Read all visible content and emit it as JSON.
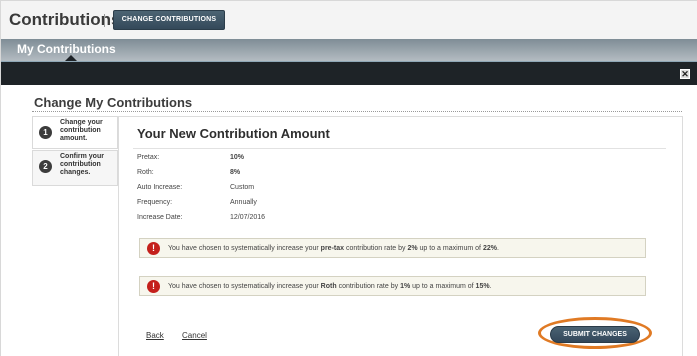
{
  "header": {
    "title": "Contributions",
    "change_button": "CHANGE CONTRIBUTIONS",
    "sub_tab": "My Contributions",
    "close_glyph": "✕"
  },
  "modal": {
    "title": "Change My Contributions",
    "steps": [
      {
        "number": "1",
        "label": "Change your contribution amount."
      },
      {
        "number": "2",
        "label": "Confirm your contribution changes."
      }
    ],
    "panel_title": "Your New Contribution Amount",
    "fields": [
      {
        "key": "Pretax:",
        "value": "10%"
      },
      {
        "key": "Roth:",
        "value": "8%"
      },
      {
        "key": "Auto Increase:",
        "value": "Custom"
      },
      {
        "key": "Frequency:",
        "value": "Annually"
      },
      {
        "key": "Increase Date:",
        "value": "12/07/2016"
      }
    ],
    "notices": [
      {
        "icon": "!",
        "prefix": "You have chosen to systematically increase your ",
        "type": "pre-tax",
        "middle": " contribution rate by ",
        "rate": "2%",
        "middle2": " up to a maximum of ",
        "max": "22%",
        "suffix": "."
      },
      {
        "icon": "!",
        "prefix": "You have chosen to systematically increase your ",
        "type": "Roth",
        "middle": " contribution rate by ",
        "rate": "1%",
        "middle2": " up to a maximum of ",
        "max": "15%",
        "suffix": "."
      }
    ],
    "back_link": "Back",
    "cancel_link": "Cancel",
    "submit_button": "SUBMIT CHANGES"
  },
  "colors": {
    "accent_button": "#3d5466",
    "alert_red": "#c4201c",
    "highlight_orange": "#e07a24",
    "dark_bar": "#1e2327"
  }
}
